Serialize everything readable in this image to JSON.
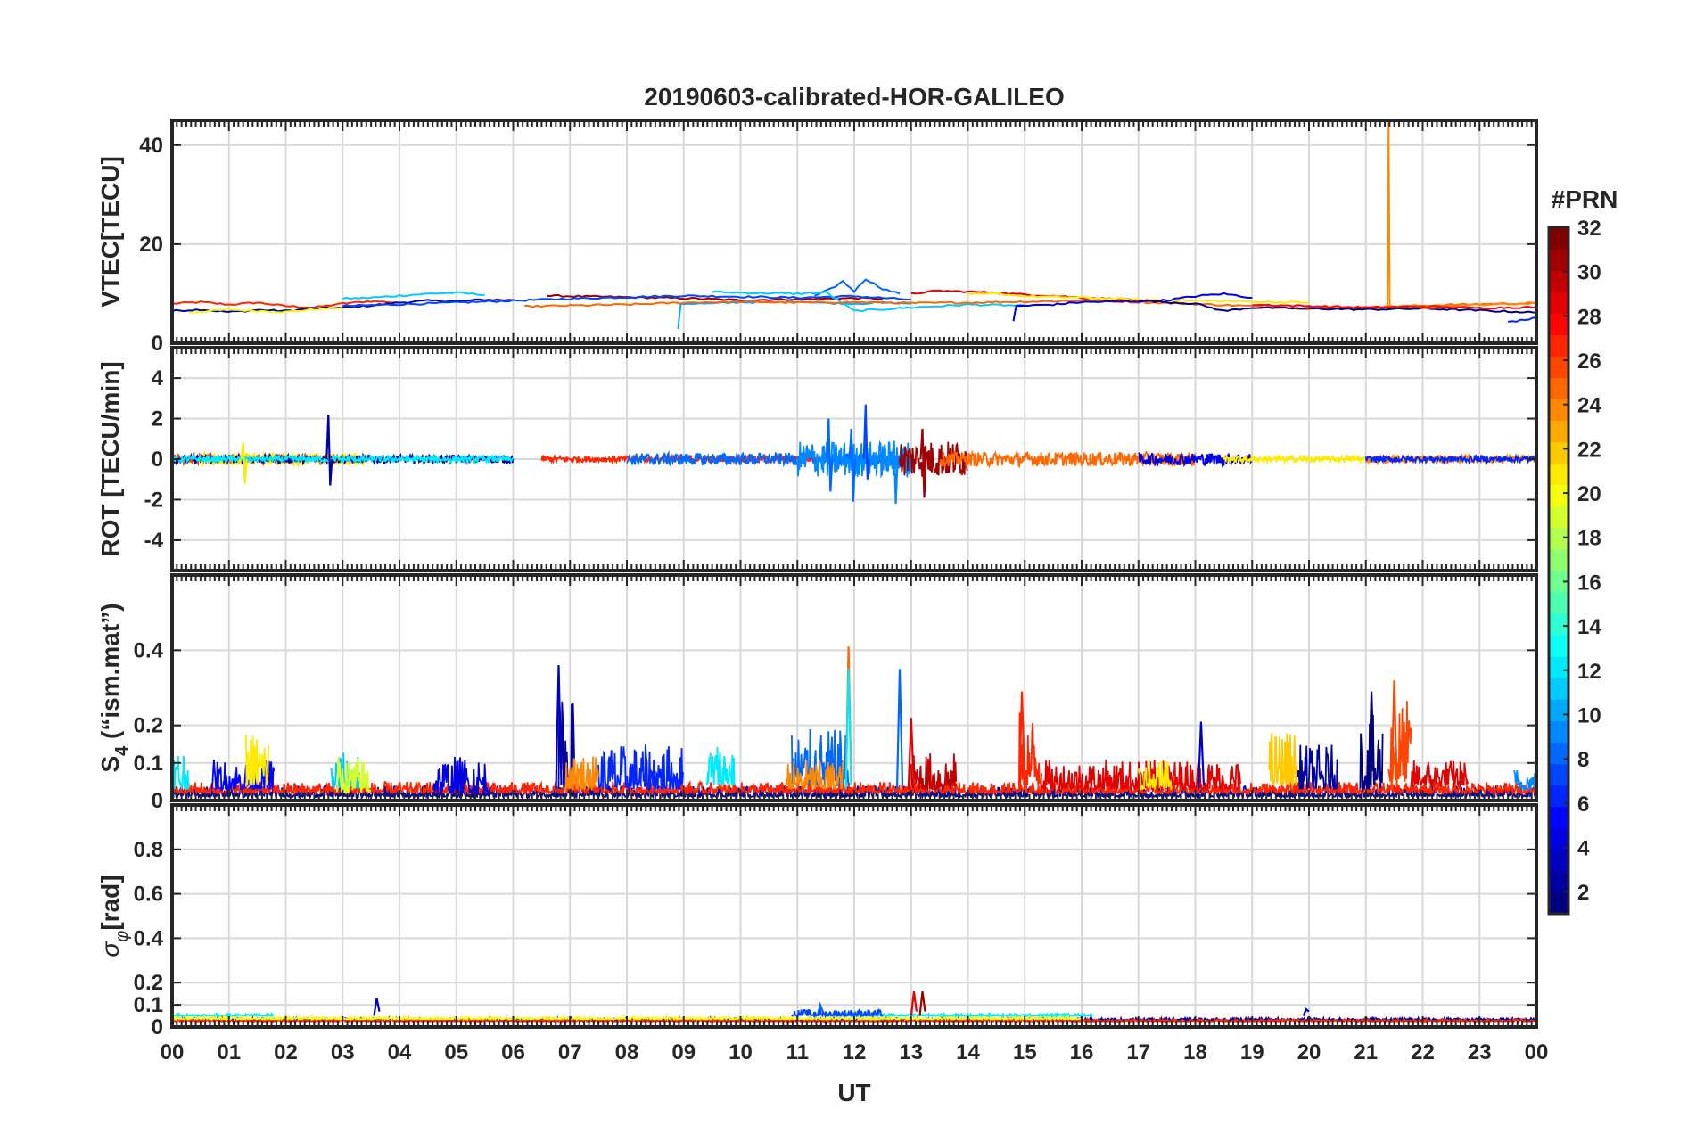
{
  "chart_data": {
    "type": "line",
    "title": "20190603-calibrated-HOR-GALILEO",
    "xlabel": "UT",
    "x_tick_labels": [
      "00",
      "01",
      "02",
      "03",
      "04",
      "05",
      "06",
      "07",
      "08",
      "09",
      "10",
      "11",
      "12",
      "13",
      "14",
      "15",
      "16",
      "17",
      "18",
      "19",
      "20",
      "21",
      "22",
      "23",
      "00"
    ],
    "x_range_hours": [
      0,
      24
    ],
    "grid": true,
    "colorbar": {
      "label": "#PRN",
      "range": [
        1,
        32
      ],
      "ticks": [
        2,
        4,
        6,
        8,
        10,
        12,
        14,
        16,
        18,
        20,
        22,
        24,
        26,
        28,
        30,
        32
      ],
      "colormap": "jet",
      "placement": "right"
    },
    "panels": [
      {
        "name": "vtec",
        "ylabel": "VTEC[TECU]",
        "ylim": [
          0,
          45
        ],
        "yticks": [
          0,
          20,
          40
        ],
        "series": [
          {
            "prn": 27,
            "x": [
              0,
              0.5,
              1,
              1.5,
              2,
              2.5,
              3,
              3.5,
              4
            ],
            "y": [
              8,
              8.3,
              7.8,
              8.2,
              7.5,
              7.2,
              8,
              8.5,
              8.2
            ]
          },
          {
            "prn": 2,
            "x": [
              0,
              0.5,
              1,
              1.5,
              2,
              2.5,
              3,
              3.5,
              4,
              4.5,
              5,
              5.5,
              6
            ],
            "y": [
              6.5,
              6.8,
              6.3,
              6.7,
              6.5,
              7,
              7.2,
              7.6,
              8.2,
              8.6,
              8.5,
              8.8,
              8.7
            ]
          },
          {
            "prn": 20,
            "x": [
              0.3,
              1,
              1.5,
              2,
              2.5,
              3
            ],
            "y": [
              6.2,
              6.8,
              6.5,
              6.3,
              6.8,
              7.2
            ]
          },
          {
            "prn": 11,
            "x": [
              3,
              3.5,
              4,
              4.5,
              5,
              5.5
            ],
            "y": [
              9,
              9.2,
              9.6,
              10,
              10.2,
              9.8
            ]
          },
          {
            "prn": 31,
            "x": [
              6.6,
              7,
              8,
              9,
              10,
              11,
              12,
              12.5
            ],
            "y": [
              9.6,
              9.5,
              9.3,
              9.1,
              8.7,
              8.9,
              9.1,
              9
            ]
          },
          {
            "prn": 7,
            "x": [
              3,
              5,
              7,
              9,
              11,
              12,
              13
            ],
            "y": [
              7.5,
              8.2,
              9,
              9.6,
              9.2,
              9.5,
              8.8
            ]
          },
          {
            "prn": 8,
            "x": [
              11.3,
              11.6,
              11.8,
              12,
              12.2,
              12.5,
              12.8
            ],
            "y": [
              9.5,
              11,
              12.5,
              10.5,
              13,
              11,
              10
            ]
          },
          {
            "prn": 10,
            "x": [
              8.9,
              8.95,
              9.5,
              10,
              10.5,
              11,
              11.5,
              12,
              12.5,
              13
            ],
            "y": [
              3,
              8,
              8,
              8.3,
              8.2,
              8.5,
              8.1,
              8,
              8.2,
              8
            ]
          },
          {
            "prn": 11,
            "x": [
              9.5,
              10,
              11,
              11.5,
              12,
              13,
              14,
              15
            ],
            "y": [
              10.4,
              10.2,
              10,
              10.3,
              6.5,
              7.2,
              7.8,
              7.6
            ]
          },
          {
            "prn": 25,
            "x": [
              6.2,
              7,
              8,
              9,
              10,
              11,
              12,
              13,
              14,
              15,
              16,
              17,
              18,
              19,
              20,
              21,
              22,
              23,
              24
            ],
            "y": [
              7.4,
              7.6,
              7.8,
              8.2,
              8.4,
              8.2,
              8.3,
              8.1,
              8.2,
              8.4,
              8.6,
              8.3,
              7.9,
              7.5,
              7,
              7.2,
              7.6,
              7.9,
              8.1
            ]
          },
          {
            "prn": 29,
            "x": [
              13,
              13.5,
              14,
              14.5,
              15,
              15.5,
              16,
              16.5,
              17
            ],
            "y": [
              10,
              10.6,
              10.4,
              10.2,
              9.8,
              9.6,
              9.2,
              9,
              8.8
            ]
          },
          {
            "prn": 21,
            "x": [
              14,
              14.5,
              15,
              16,
              17,
              18,
              19,
              20
            ],
            "y": [
              9.8,
              10,
              9.5,
              9.2,
              8.8,
              8.6,
              8.4,
              8.2
            ]
          },
          {
            "prn": 4,
            "x": [
              14.8,
              14.85,
              15.5,
              16,
              17,
              17.5,
              18,
              18.5,
              19
            ],
            "y": [
              4.5,
              7.5,
              7.8,
              8.3,
              8.5,
              8.7,
              9.5,
              10,
              9.2
            ]
          },
          {
            "prn": 1,
            "x": [
              17,
              18,
              18.5,
              19,
              20,
              21,
              22,
              23,
              24
            ],
            "y": [
              8.6,
              8,
              6.5,
              7.2,
              7,
              6.8,
              7,
              6.6,
              6.2
            ]
          },
          {
            "prn": 24,
            "x": [
              21.38,
              21.4,
              21.42,
              22,
              22.5,
              23,
              23.5,
              24
            ],
            "y": [
              7,
              45,
              7.5,
              7.2,
              7.4,
              7.8,
              7.9,
              8
            ]
          },
          {
            "prn": 28,
            "x": [
              19,
              20,
              21,
              22,
              23,
              24
            ],
            "y": [
              7.8,
              7.5,
              7.2,
              7.4,
              7.1,
              7.3
            ]
          },
          {
            "prn": 6,
            "x": [
              23.5,
              23.8,
              24
            ],
            "y": [
              4.2,
              4.8,
              5.2
            ]
          }
        ]
      },
      {
        "name": "rot",
        "ylabel": "ROT [TECU/min]",
        "ylim": [
          -5.5,
          5.5
        ],
        "yticks": [
          -4,
          -2,
          0,
          2,
          4
        ],
        "bursts": [
          {
            "prn": 26,
            "start": 0,
            "end": 3.2,
            "amp": 0.25
          },
          {
            "prn": 21,
            "start": 0.5,
            "end": 3.5,
            "amp": 0.3
          },
          {
            "prn": 2,
            "start": 0,
            "end": 6,
            "amp": 0.2
          },
          {
            "prn": 12,
            "start": 0,
            "end": 6,
            "amp": 0.15
          },
          {
            "prn": 27,
            "start": 6.5,
            "end": 11.5,
            "amp": 0.15
          },
          {
            "prn": 8,
            "start": 8,
            "end": 13,
            "amp": 0.3
          },
          {
            "prn": 9,
            "start": 11,
            "end": 13,
            "amp": 0.9
          },
          {
            "prn": 31,
            "start": 12.8,
            "end": 14,
            "amp": 0.9
          },
          {
            "prn": 25,
            "start": 13.5,
            "end": 18,
            "amp": 0.35
          },
          {
            "prn": 4,
            "start": 17,
            "end": 19,
            "amp": 0.3
          },
          {
            "prn": 21,
            "start": 18.5,
            "end": 21,
            "amp": 0.15
          },
          {
            "prn": 24,
            "start": 21,
            "end": 24,
            "amp": 0.2
          },
          {
            "prn": 6,
            "start": 21,
            "end": 24,
            "amp": 0.15
          }
        ],
        "spikes": [
          {
            "prn": 2,
            "x": 2.75,
            "y": [
              2.2,
              -1.3
            ]
          },
          {
            "prn": 21,
            "x": 1.25,
            "y": [
              0.8,
              -1.2
            ]
          },
          {
            "prn": 8,
            "x": 11.55,
            "y": [
              2.0,
              -1.6
            ]
          },
          {
            "prn": 8,
            "x": 11.95,
            "y": [
              1.5,
              -2.1
            ]
          },
          {
            "prn": 7,
            "x": 12.2,
            "y": [
              2.7,
              -1.0
            ]
          },
          {
            "prn": 9,
            "x": 12.7,
            "y": [
              0.9,
              -2.2
            ]
          },
          {
            "prn": 31,
            "x": 13.2,
            "y": [
              1.5,
              -1.9
            ]
          }
        ]
      },
      {
        "name": "s4",
        "ylabel": "S4 (\"ism.mat\")",
        "ylim": [
          0,
          0.6
        ],
        "yticks": [
          0,
          0.1,
          0.2,
          0.4
        ],
        "bursts": [
          {
            "prn": 2,
            "start": 0,
            "end": 24,
            "amp": 0.03,
            "base": 0.01
          },
          {
            "prn": 27,
            "start": 0,
            "end": 24,
            "amp": 0.03,
            "base": 0.02
          },
          {
            "prn": 12,
            "start": 0,
            "end": 0.3,
            "amp": 0.12,
            "base": 0.03
          },
          {
            "prn": 5,
            "start": 0.7,
            "end": 1.8,
            "amp": 0.08,
            "base": 0.03
          },
          {
            "prn": 21,
            "start": 1.3,
            "end": 1.7,
            "amp": 0.15,
            "base": 0.04
          },
          {
            "prn": 11,
            "start": 2.8,
            "end": 3.3,
            "amp": 0.1,
            "base": 0.03
          },
          {
            "prn": 19,
            "start": 2.9,
            "end": 3.5,
            "amp": 0.1,
            "base": 0.02
          },
          {
            "prn": 4,
            "start": 4.6,
            "end": 5.6,
            "amp": 0.1,
            "base": 0.02
          },
          {
            "prn": 2,
            "start": 6.8,
            "end": 7.1,
            "amp": 0.25,
            "base": 0.03
          },
          {
            "prn": 6,
            "start": 7.5,
            "end": 9.0,
            "amp": 0.12,
            "base": 0.03
          },
          {
            "prn": 24,
            "start": 6.9,
            "end": 7.5,
            "amp": 0.1,
            "base": 0.03
          },
          {
            "prn": 12,
            "start": 9.4,
            "end": 9.9,
            "amp": 0.12,
            "base": 0.04
          },
          {
            "prn": 8,
            "start": 10.9,
            "end": 11.9,
            "amp": 0.15,
            "base": 0.04
          },
          {
            "prn": 24,
            "start": 10.8,
            "end": 11.8,
            "amp": 0.08,
            "base": 0.03
          },
          {
            "prn": 30,
            "start": 13.0,
            "end": 13.8,
            "amp": 0.1,
            "base": 0.03
          },
          {
            "prn": 27,
            "start": 14.9,
            "end": 15.3,
            "amp": 0.2,
            "base": 0.04
          },
          {
            "prn": 29,
            "start": 15.3,
            "end": 18.8,
            "amp": 0.08,
            "base": 0.03
          },
          {
            "prn": 21,
            "start": 17.0,
            "end": 17.6,
            "amp": 0.08,
            "base": 0.03
          },
          {
            "prn": 22,
            "start": 19.3,
            "end": 19.8,
            "amp": 0.15,
            "base": 0.04
          },
          {
            "prn": 2,
            "start": 19.8,
            "end": 20.5,
            "amp": 0.12,
            "base": 0.03
          },
          {
            "prn": 1,
            "start": 20.9,
            "end": 21.3,
            "amp": 0.2,
            "base": 0.03
          },
          {
            "prn": 26,
            "start": 21.4,
            "end": 21.8,
            "amp": 0.22,
            "base": 0.05
          },
          {
            "prn": 29,
            "start": 21.8,
            "end": 22.8,
            "amp": 0.07,
            "base": 0.04
          },
          {
            "prn": 9,
            "start": 23.6,
            "end": 24,
            "amp": 0.06,
            "base": 0.03
          }
        ],
        "spikes": [
          {
            "prn": 3,
            "x": 6.8,
            "y": 0.36
          },
          {
            "prn": 25,
            "x": 11.9,
            "y": 0.41
          },
          {
            "prn": 12,
            "x": 11.9,
            "y": 0.35
          },
          {
            "prn": 8,
            "x": 12.8,
            "y": 0.35
          },
          {
            "prn": 29,
            "x": 13.0,
            "y": 0.22
          },
          {
            "prn": 27,
            "x": 14.95,
            "y": 0.29
          },
          {
            "prn": 3,
            "x": 18.1,
            "y": 0.21
          },
          {
            "prn": 1,
            "x": 21.1,
            "y": 0.29
          },
          {
            "prn": 26,
            "x": 21.5,
            "y": 0.32
          }
        ]
      },
      {
        "name": "sigma_phi",
        "ylabel": "σφ[rad]",
        "ylim": [
          0,
          1
        ],
        "yticks": [
          0,
          0.1,
          0.2,
          0.4,
          0.6,
          0.8
        ],
        "bursts": [
          {
            "prn": 12,
            "start": 0,
            "end": 1.8,
            "amp": 0.01,
            "base": 0.05
          },
          {
            "prn": 2,
            "start": 0,
            "end": 24,
            "amp": 0.01,
            "base": 0.03
          },
          {
            "prn": 27,
            "start": 0,
            "end": 24,
            "amp": 0.01,
            "base": 0.025
          },
          {
            "prn": 20,
            "start": 0,
            "end": 16,
            "amp": 0.01,
            "base": 0.035
          },
          {
            "prn": 12,
            "start": 11.5,
            "end": 16.2,
            "amp": 0.01,
            "base": 0.05
          },
          {
            "prn": 7,
            "start": 10.9,
            "end": 12.5,
            "amp": 0.03,
            "base": 0.05
          }
        ],
        "spikes": [
          {
            "prn": 3,
            "x": 3.6,
            "y": 0.13
          },
          {
            "prn": 29,
            "x": 13.05,
            "y": 0.16
          },
          {
            "prn": 31,
            "x": 13.2,
            "y": 0.16
          },
          {
            "prn": 8,
            "x": 11.4,
            "y": 0.1
          },
          {
            "prn": 3,
            "x": 19.95,
            "y": 0.08
          }
        ]
      }
    ]
  }
}
